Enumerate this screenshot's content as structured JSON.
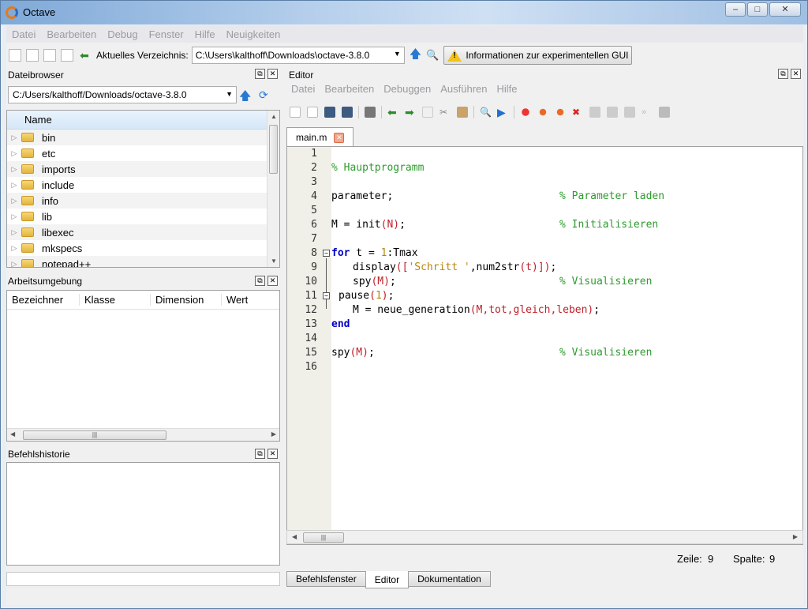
{
  "window": {
    "title": "Octave",
    "buttons": [
      "–",
      "□",
      "✕"
    ]
  },
  "menu": [
    "Datei",
    "Bearbeiten",
    "Debug",
    "Fenster",
    "Hilfe",
    "Neuigkeiten"
  ],
  "toolbar": {
    "current_dir_label": "Aktuelles Verzeichnis:",
    "current_dir_value": "C:\\Users\\kalthoff\\Downloads\\octave-3.8.0",
    "info_button": "Informationen zur experimentellen GUI"
  },
  "file_browser": {
    "title": "Dateibrowser",
    "path": "C:/Users/kalthoff/Downloads/octave-3.8.0",
    "column": "Name",
    "items": [
      "bin",
      "etc",
      "imports",
      "include",
      "info",
      "lib",
      "libexec",
      "mkspecs",
      "notepad++"
    ]
  },
  "workspace": {
    "title": "Arbeitsumgebung",
    "columns": [
      "Bezeichner",
      "Klasse",
      "Dimension",
      "Wert"
    ]
  },
  "history": {
    "title": "Befehlshistorie"
  },
  "editor": {
    "title": "Editor",
    "menu": [
      "Datei",
      "Bearbeiten",
      "Debuggen",
      "Ausführen",
      "Hilfe"
    ],
    "tab": "main.m",
    "status_line_label": "Zeile:",
    "status_line_value": "9",
    "status_col_label": "Spalte:",
    "status_col_value": "9",
    "line_numbers": [
      "1",
      "2",
      "3",
      "4",
      "5",
      "6",
      "7",
      "8",
      "9",
      "10",
      "11",
      "12",
      "13",
      "14",
      "15",
      "16"
    ]
  },
  "bottom_tabs": [
    "Befehlsfenster",
    "Editor",
    "Dokumentation"
  ],
  "code": {
    "l2_comment": "% Hauptprogramm",
    "l4_code": "parameter;",
    "l4_comment": "% Parameter laden",
    "l6_a": "M = init",
    "l6_b": "(N)",
    "l6_c": ";",
    "l6_comment": "% Initialisieren",
    "l8_kw": "for",
    "l8_a": " t = ",
    "l8_num": "1",
    "l8_b": ":Tmax",
    "l9_a": "display",
    "l9_b": "([",
    "l9_str": "'Schritt '",
    "l9_c": ",num2str",
    "l9_d": "(t)])",
    "l9_e": ";",
    "l10_a": "spy",
    "l10_b": "(M)",
    "l10_c": ";",
    "l10_comment": "% Visualisieren",
    "l11_a": "pause",
    "l11_b": "(",
    "l11_num": "1",
    "l11_c": ")",
    "l11_d": ";",
    "l12_a": "M = neue_generation",
    "l12_b": "(M,tot,gleich,leben)",
    "l12_c": ";",
    "l13_kw": "end",
    "l15_a": "spy",
    "l15_b": "(M)",
    "l15_c": ";",
    "l15_comment": "% Visualisieren"
  }
}
